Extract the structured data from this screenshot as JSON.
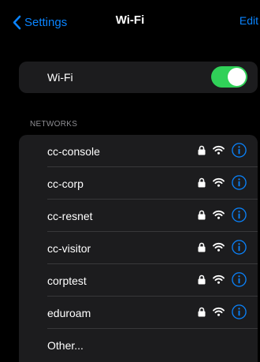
{
  "navbar": {
    "back_label": "Settings",
    "title": "Wi-Fi",
    "edit_label": "Edit"
  },
  "wifi": {
    "label": "Wi-Fi",
    "enabled": true
  },
  "networks": {
    "header": "NETWORKS",
    "items": [
      {
        "name": "cc-console",
        "secured": true
      },
      {
        "name": "cc-corp",
        "secured": true
      },
      {
        "name": "cc-resnet",
        "secured": true
      },
      {
        "name": "cc-visitor",
        "secured": true
      },
      {
        "name": "corptest",
        "secured": true
      },
      {
        "name": "eduroam",
        "secured": true
      }
    ],
    "other_label": "Other..."
  },
  "colors": {
    "accent": "#0a84ff",
    "toggle_on": "#30d158",
    "cell_background": "#1c1c1e",
    "separator": "#38383a",
    "section_header": "#8e8e93"
  },
  "icons": {
    "back": "chevron-left-icon",
    "lock": "lock-icon",
    "signal": "wifi-icon",
    "info": "info-icon"
  }
}
